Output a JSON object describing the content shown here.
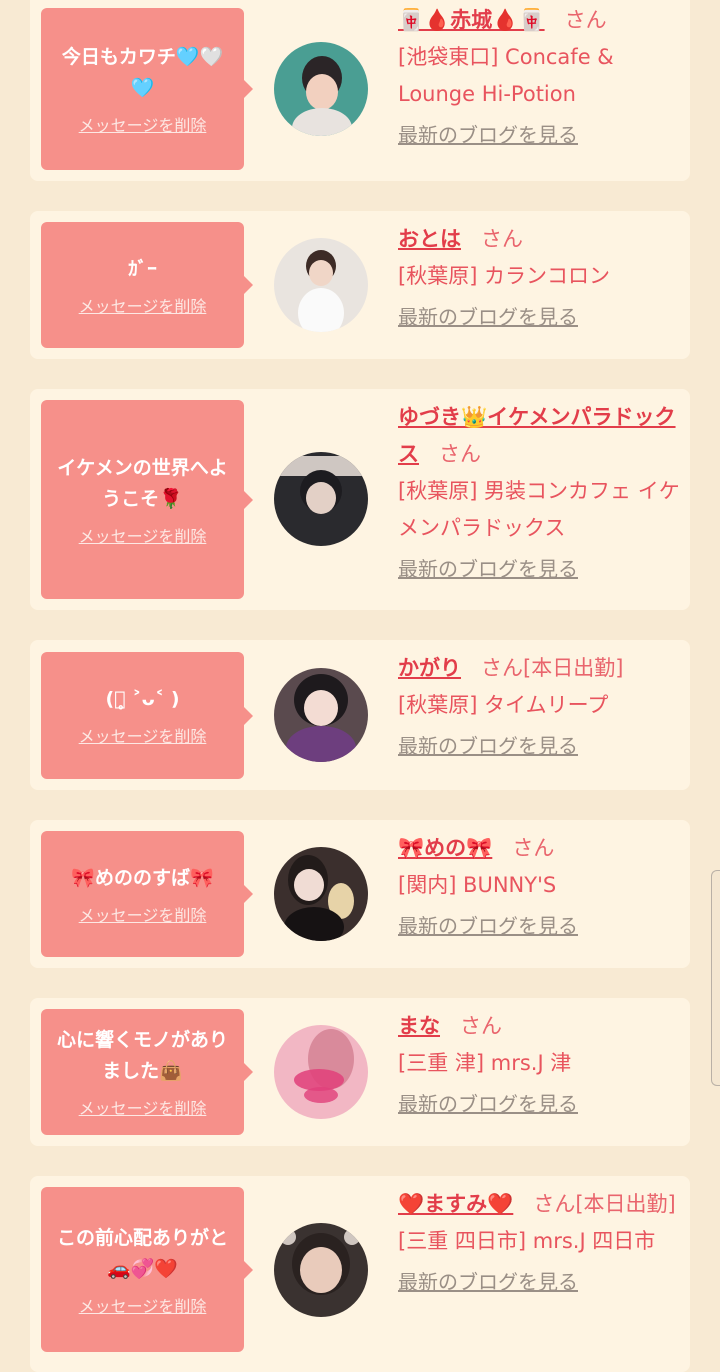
{
  "delete_label": "メッセージを削除",
  "san": "さん",
  "blog_label": "最新のブログを見る",
  "messages": [
    {
      "msg": "今日もカワチ🩵🤍🩵",
      "name": "🀄🩸赤城🩸🀄",
      "extra": "",
      "shop": "[池袋東口] Concafe & Lounge Hi-Potion"
    },
    {
      "msg": "ｶﾞｰ",
      "name": "おとは",
      "extra": "",
      "shop": "[秋葉原] カランコロン"
    },
    {
      "msg": "イケメンの世界へようこそ🌹",
      "name": "ゆづき👑イケメンパラドックス",
      "extra": "",
      "shop": "[秋葉原] 男装コンカフェ イケメンパラドックス"
    },
    {
      "msg": "(ﾞ̥ ˃ᴗ˂ )",
      "name": "かがり",
      "extra": "[本日出勤]",
      "shop": "[秋葉原] タイムリープ"
    },
    {
      "msg": "🎀めののすば🎀",
      "name": "🎀めの🎀",
      "extra": "",
      "shop": "[関内] BUNNY'S"
    },
    {
      "msg": "心に響くモノがありました👜",
      "name": "まな",
      "extra": "",
      "shop": "[三重 津] mrs.J 津"
    },
    {
      "msg": "この前心配ありがと🚗💞❤️",
      "name": "❤️ますみ❤️",
      "extra": "[本日出勤]",
      "shop": "[三重 四日市] mrs.J 四日市"
    }
  ]
}
